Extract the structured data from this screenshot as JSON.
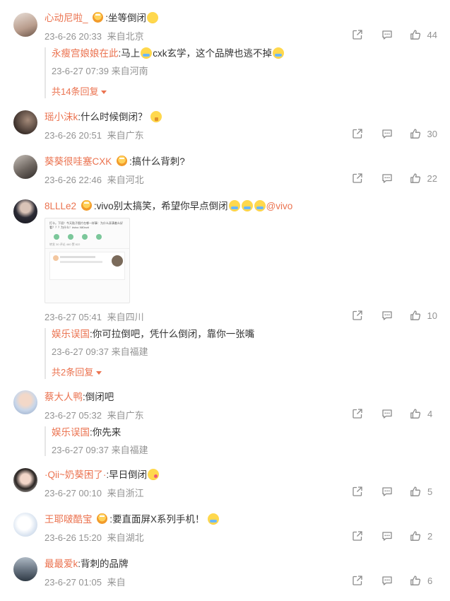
{
  "comments": [
    {
      "user": "心动尼啦_",
      "text": ":坐等倒闭",
      "date": "23-6-26 20:33",
      "location": "来自北京",
      "likes": "44",
      "reply": {
        "user": "永瘦宫娘娘在此",
        "text_a": ":马上",
        "text_b": "cxk玄学，这个品牌也逃不掉",
        "date": "23-6-27 07:39",
        "location": "来自河南"
      },
      "more": "共14条回复"
    },
    {
      "user": "瑶小沫k",
      "text": ":什么时候倒闭？",
      "date": "23-6-26 20:51",
      "location": "来自广东",
      "likes": "30"
    },
    {
      "user": "葵葵很哇塞CXK",
      "text": ":搞什么背刺?",
      "date": "23-6-26 22:46",
      "location": "来自河北",
      "likes": "22"
    },
    {
      "user": "8LLLe2",
      "text": ":vivo别太搞笑，希望你早点倒闭",
      "mention": "@vivo",
      "date": "23-6-27 05:41",
      "location": "来自四川",
      "likes": "10",
      "image_caption": "打卡。下班！今天贴子图片在哪一样事：为什么弄满着么好看？？？为什么！#vivo X80vv#",
      "image_tabs": "转发 30    评论 460    赞 822",
      "reply": {
        "user": "娱乐误国",
        "text": ":你可拉倒吧，凭什么倒闭，靠你一张嘴",
        "date": "23-6-27 09:37",
        "location": "来自福建"
      },
      "more": "共2条回复"
    },
    {
      "user": "蔡大人鸭",
      "text": ":倒闭吧",
      "date": "23-6-27 05:32",
      "location": "来自广东",
      "likes": "4",
      "reply": {
        "user": "娱乐误国",
        "text": ":你先来",
        "date": "23-6-27 09:37",
        "location": "来自福建"
      }
    },
    {
      "user": "·Qii~奶葵困了·",
      "text": ":早日倒闭",
      "date": "23-6-27 00:10",
      "location": "来自浙江",
      "likes": "5"
    },
    {
      "user": "王耶啵酷宝",
      "text": ":要直面屏X系列手机！",
      "date": "23-6-26 15:20",
      "location": "来自湖北",
      "likes": "2"
    },
    {
      "user": "最最爱k",
      "text": ":背刺的品牌",
      "date": "23-6-27 01:05",
      "location": "来自",
      "likes": "6"
    }
  ],
  "colors": {
    "username": "#eb7350",
    "meta": "#939393",
    "text": "#333333"
  },
  "icons": [
    "share-icon",
    "comment-icon",
    "like-icon",
    "vip-badge-icon",
    "emoji-icon"
  ]
}
